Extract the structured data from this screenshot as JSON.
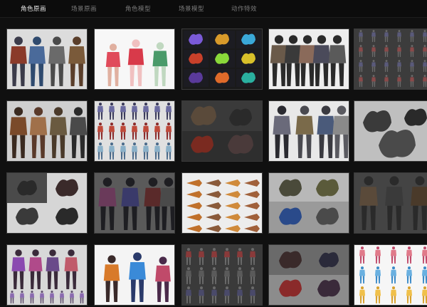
{
  "tabs": [
    {
      "label": "角色原画",
      "active": true
    },
    {
      "label": "场景原画",
      "active": false
    },
    {
      "label": "角色模型",
      "active": false
    },
    {
      "label": "场景模型",
      "active": false
    },
    {
      "label": "动作特效",
      "active": false
    }
  ],
  "colors": {
    "background": "#101010",
    "tab_active": "#e6e6e6",
    "tab_inactive": "#7a7a7a"
  },
  "gallery": {
    "tiles": [
      {
        "style": "warriors-lineup",
        "bg": "#dcdcdc"
      },
      {
        "style": "anime-girls",
        "bg": "#f7f7f7"
      },
      {
        "style": "color-creature-grid",
        "bg": "#1a1a1a"
      },
      {
        "style": "female-armor-lineup",
        "bg": "#eeeeee"
      },
      {
        "style": "gray-model-grid",
        "bg": "#3c3c3c"
      },
      {
        "style": "robed-figures",
        "bg": "#cfcfcf"
      },
      {
        "style": "small-figure-rows",
        "bg": "#e0e0e0"
      },
      {
        "style": "dark-creatures",
        "bg": "#2e2e2e"
      },
      {
        "style": "armored-knights",
        "bg": "#e8e8e8"
      },
      {
        "style": "dragon-sketches",
        "bg": "#bfbfbf"
      },
      {
        "style": "dark-beast-panels",
        "bg": "#d6d6d6"
      },
      {
        "style": "dark-warriors-row",
        "bg": "#5a5a5a"
      },
      {
        "style": "weapon-sheet",
        "bg": "#ededed"
      },
      {
        "style": "beast-panels-gray",
        "bg": "#9a9a9a"
      },
      {
        "style": "demon-trio",
        "bg": "#444444"
      },
      {
        "style": "purple-heroines",
        "bg": "#d8d8d8"
      },
      {
        "style": "colorful-heroes",
        "bg": "#f4f4f4"
      },
      {
        "style": "monster-lineup",
        "bg": "#3a3a3a"
      },
      {
        "style": "creature-panels-red",
        "bg": "#8c8c8c"
      },
      {
        "style": "character-sheet-color",
        "bg": "#f6f6f6"
      }
    ]
  }
}
